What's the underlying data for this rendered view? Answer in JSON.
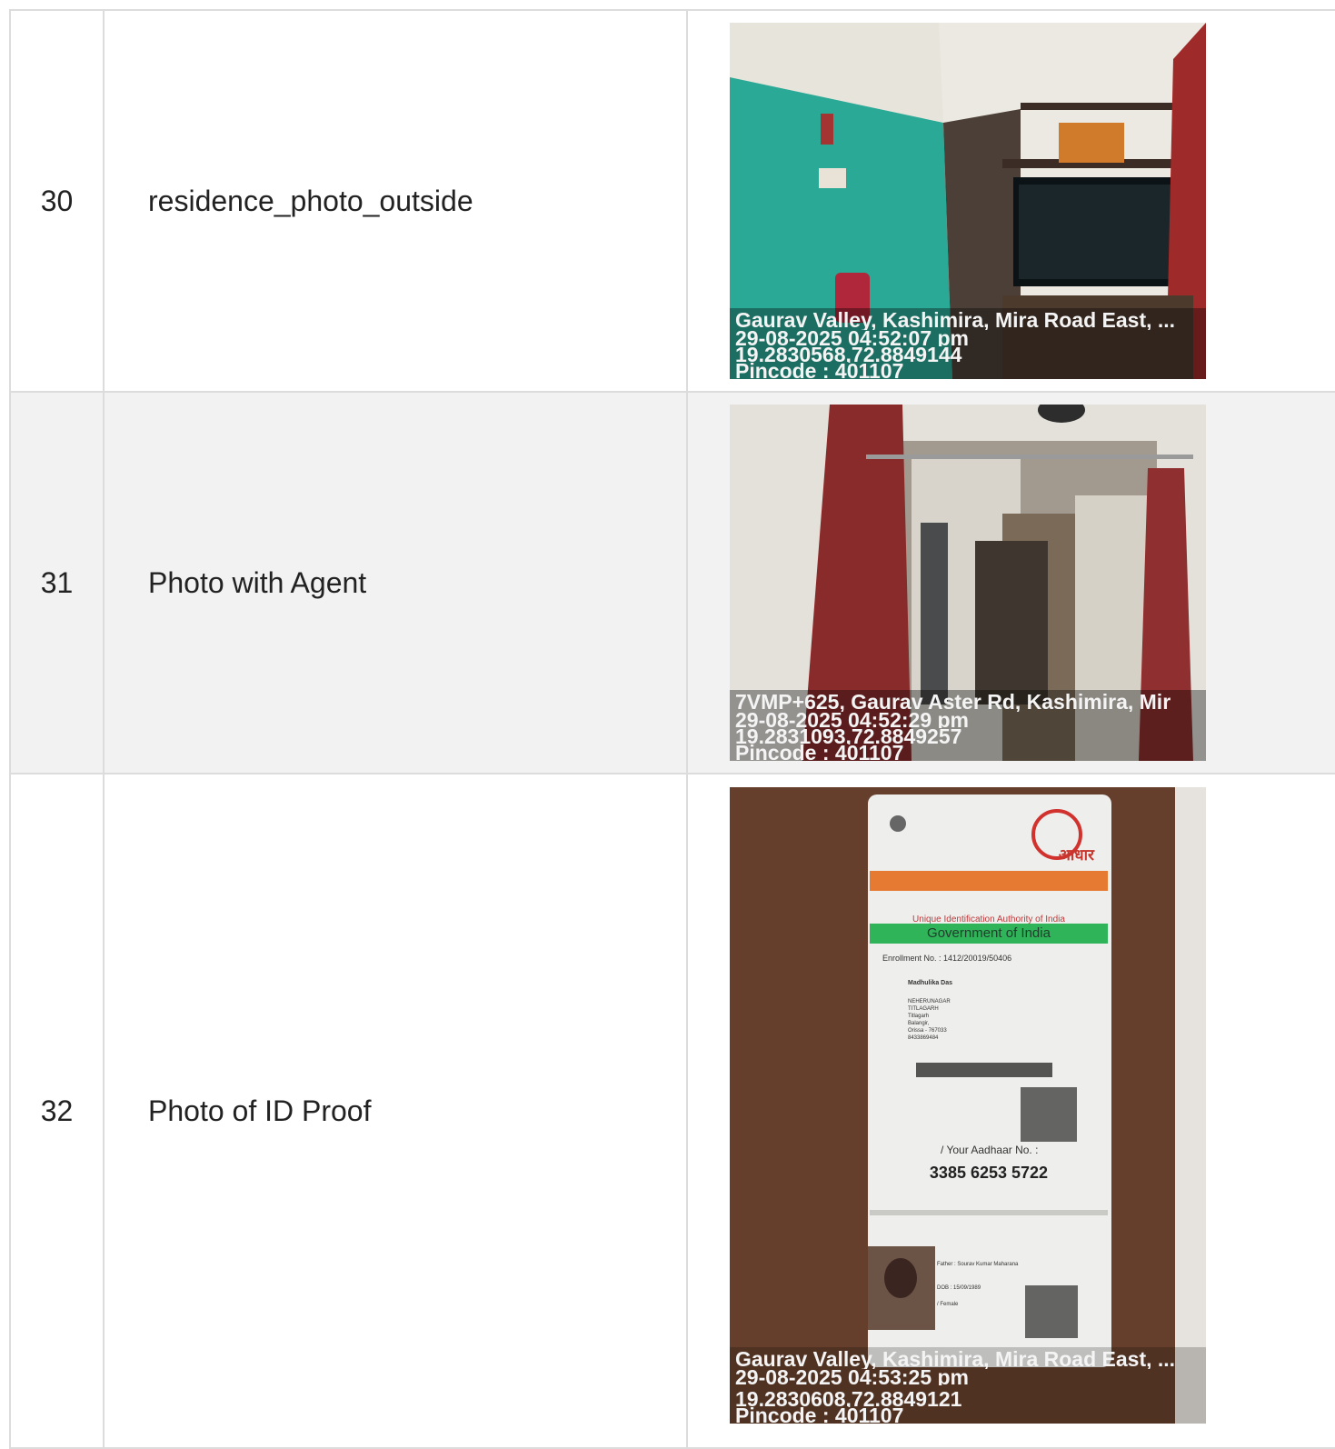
{
  "rows": [
    {
      "num": "30",
      "label": "residence_photo_outside",
      "stamp": {
        "address": "Gaurav Valley, Kashimira, Mira Road East, ...",
        "datetime": "29-08-2025 04:52:07 pm",
        "coords": "19.2830568,72.8849144",
        "pincode": "Pincode : 401107"
      }
    },
    {
      "num": "31",
      "label": "Photo with Agent",
      "stamp": {
        "address": "7VMP+625, Gaurav Aster Rd, Kashimira, Mir",
        "datetime": "29-08-2025 04:52:29 pm",
        "coords": "19.2831093,72.8849257",
        "pincode": "Pincode : 401107"
      }
    },
    {
      "num": "32",
      "label": "Photo of ID Proof",
      "stamp": {
        "address": "Gaurav Valley, Kashimira, Mira Road East, ...",
        "datetime": "29-08-2025 04:53:25 pm",
        "coords": "19.2830608,72.8849121",
        "pincode": "Pincode : 401107"
      },
      "card": {
        "aadhaar_logo": "आधार",
        "gov_india": "Government of India",
        "uidai": "Unique Identification Authority of India",
        "enrollment": "Enrollment No. : 1412/20019/50406",
        "name": "Madhulika Das",
        "addr_lines": [
          "NEHERUNAGAR",
          "TITLAGARH",
          "Titlagarh",
          "Balangir,",
          "Orissa - 767033",
          "8433869484"
        ],
        "your_aadhaar": "/ Your Aadhaar No. :",
        "number": "3385 6253 5722",
        "father": "Father : Sourav Kumar Maharana",
        "dob": "DOB : 15/09/1989",
        "gender": "/ Female"
      }
    }
  ]
}
